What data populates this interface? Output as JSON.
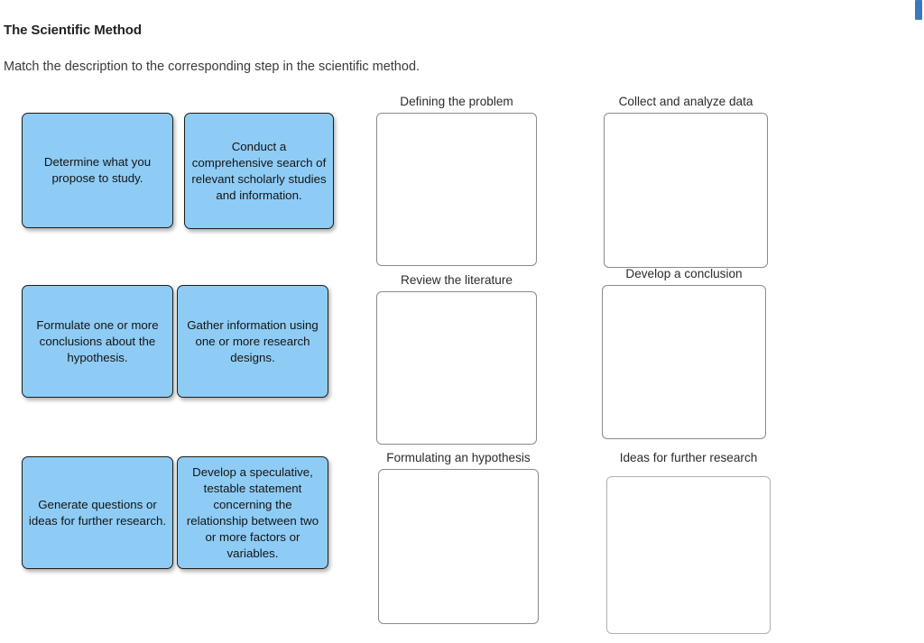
{
  "page": {
    "title": "The Scientific Method",
    "instruction": "Match the description to the corresponding step in the scientific method."
  },
  "theme": {
    "card_fill": "#8ECCF5",
    "card_border": "#1c1c1c",
    "dropzone_border": "#8a8a8a",
    "dropzone_border_light": "#b0b0b0",
    "scrollbar_thumb": "#3c78bd",
    "background": "#ffffff",
    "text": "#1a1a1a"
  },
  "drag_cards": [
    {
      "id": "card-determine-what-you-propose-to-study",
      "text": "Determine what you propose to study."
    },
    {
      "id": "card-conduct-a-comprehensive-search",
      "text": "Conduct a comprehensive search of relevant scholarly studies and information."
    },
    {
      "id": "card-formulate-conclusions",
      "text": "Formulate one or more conclusions about the hypothesis."
    },
    {
      "id": "card-gather-information",
      "text": "Gather information using one or more research designs."
    },
    {
      "id": "card-generate-questions",
      "text": "Generate questions or ideas for further research."
    },
    {
      "id": "card-develop-a-speculative-statement",
      "text": "Develop a speculative, testable statement concerning the relationship between two or more factors or variables."
    }
  ],
  "drop_zones": [
    {
      "id": "dropzone-defining-the-problem",
      "label": "Defining the problem",
      "content": ""
    },
    {
      "id": "dropzone-collect-and-analyze-data",
      "label": "Collect and analyze data",
      "content": ""
    },
    {
      "id": "dropzone-review-the-literature",
      "label": "Review the literature",
      "content": ""
    },
    {
      "id": "dropzone-develop-a-conclusion",
      "label": "Develop a conclusion",
      "content": ""
    },
    {
      "id": "dropzone-formulating-an-hypothesis",
      "label": "Formulating an hypothesis",
      "content": ""
    },
    {
      "id": "dropzone-ideas-for-further-research",
      "label": "Ideas for further research",
      "content": ""
    }
  ]
}
